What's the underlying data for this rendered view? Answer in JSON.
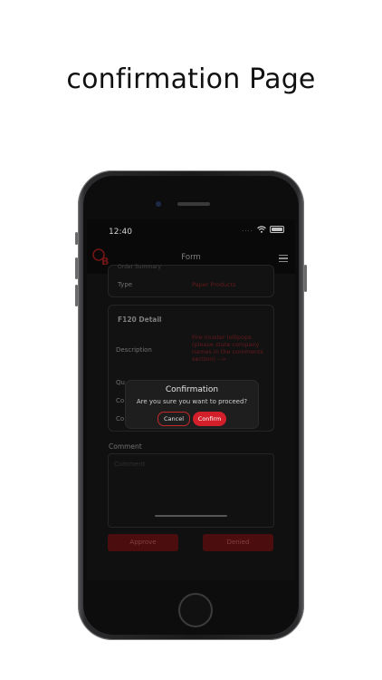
{
  "headline": "confirmation Page",
  "status": {
    "time": "12:40",
    "signal": "...."
  },
  "nav": {
    "title": "Form",
    "logo": "OB",
    "menu_icon": "hamburger-icon"
  },
  "top_card": {
    "cut_label": "Order Summary",
    "type_label": "Type",
    "type_value": "Paper Products"
  },
  "detail_card": {
    "title": "F120 Detail",
    "description_label": "Description",
    "description_value": "Fire muster lollipops (please state company names in the comments section) -->",
    "row2_label": "Qu",
    "row3_label": "Co",
    "row4_label": "Co"
  },
  "comment": {
    "label": "Comment",
    "placeholder": "Comment"
  },
  "actions": {
    "approve": "Approve",
    "denied": "Denied"
  },
  "dialog": {
    "title": "Confirmation",
    "message": "Are you sure you want to proceed?",
    "cancel": "Cancel",
    "confirm": "Confirm"
  },
  "colors": {
    "accent_red": "#d21f2a",
    "dark_red": "#5c1010",
    "screen_bg": "#141415"
  }
}
